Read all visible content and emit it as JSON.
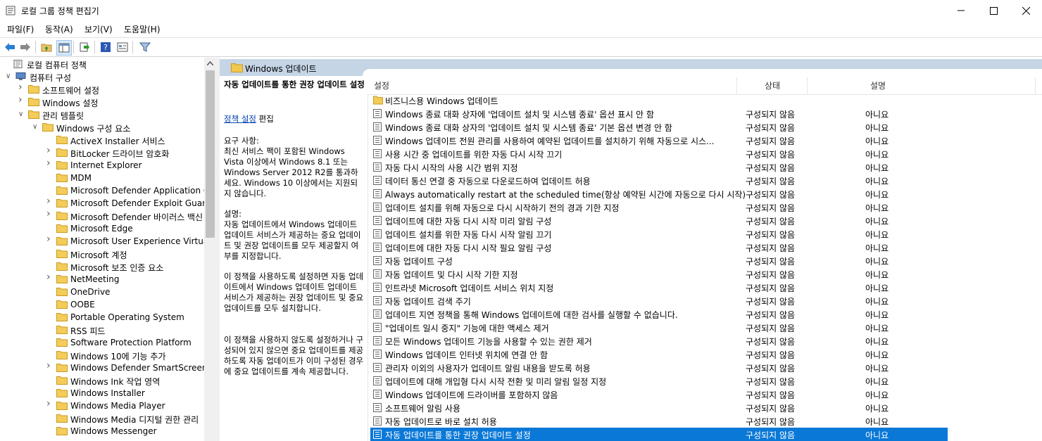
{
  "window": {
    "title": "로컬 그룹 정책 편집기"
  },
  "menu": [
    "파일(F)",
    "동작(A)",
    "보기(V)",
    "도움말(H)"
  ],
  "tree": [
    {
      "label": "로컬 컴퓨터 정책",
      "level": 0,
      "chev": "",
      "icon": "policy-icon"
    },
    {
      "label": "컴퓨터 구성",
      "level": 1,
      "chev": "open",
      "icon": "computer-icon"
    },
    {
      "label": "소프트웨어 설정",
      "level": 2,
      "chev": "closed",
      "icon": "folder-icon"
    },
    {
      "label": "Windows 설정",
      "level": 2,
      "chev": "closed",
      "icon": "folder-icon"
    },
    {
      "label": "관리 템플릿",
      "level": 2,
      "chev": "open",
      "icon": "folder-icon"
    },
    {
      "label": "Windows 구성 요소",
      "level": 3,
      "chev": "open",
      "icon": "folder-icon"
    },
    {
      "label": "ActiveX Installer 서비스",
      "level": 4,
      "chev": "",
      "icon": "folder-icon"
    },
    {
      "label": "BitLocker 드라이브 암호화",
      "level": 4,
      "chev": "closed",
      "icon": "folder-icon"
    },
    {
      "label": "Internet Explorer",
      "level": 4,
      "chev": "closed",
      "icon": "folder-icon"
    },
    {
      "label": "MDM",
      "level": 4,
      "chev": "",
      "icon": "folder-icon"
    },
    {
      "label": "Microsoft Defender Application Gu",
      "level": 4,
      "chev": "",
      "icon": "folder-icon"
    },
    {
      "label": "Microsoft Defender Exploit Guard",
      "level": 4,
      "chev": "closed",
      "icon": "folder-icon"
    },
    {
      "label": "Microsoft Defender 바이러스 백신",
      "level": 4,
      "chev": "closed",
      "icon": "folder-icon"
    },
    {
      "label": "Microsoft Edge",
      "level": 4,
      "chev": "",
      "icon": "folder-icon"
    },
    {
      "label": "Microsoft User Experience Virtualiz",
      "level": 4,
      "chev": "closed",
      "icon": "folder-icon"
    },
    {
      "label": "Microsoft 계정",
      "level": 4,
      "chev": "",
      "icon": "folder-icon"
    },
    {
      "label": "Microsoft 보조 인증 요소",
      "level": 4,
      "chev": "",
      "icon": "folder-icon"
    },
    {
      "label": "NetMeeting",
      "level": 4,
      "chev": "closed",
      "icon": "folder-icon"
    },
    {
      "label": "OneDrive",
      "level": 4,
      "chev": "",
      "icon": "folder-icon"
    },
    {
      "label": "OOBE",
      "level": 4,
      "chev": "",
      "icon": "folder-icon"
    },
    {
      "label": "Portable Operating System",
      "level": 4,
      "chev": "",
      "icon": "folder-icon"
    },
    {
      "label": "RSS 피드",
      "level": 4,
      "chev": "",
      "icon": "folder-icon"
    },
    {
      "label": "Software Protection Platform",
      "level": 4,
      "chev": "",
      "icon": "folder-icon"
    },
    {
      "label": "Windows 10에 기능 추가",
      "level": 4,
      "chev": "",
      "icon": "folder-icon"
    },
    {
      "label": "Windows Defender SmartScreen",
      "level": 4,
      "chev": "closed",
      "icon": "folder-icon"
    },
    {
      "label": "Windows Ink 작업 영역",
      "level": 4,
      "chev": "",
      "icon": "folder-icon"
    },
    {
      "label": "Windows Installer",
      "level": 4,
      "chev": "",
      "icon": "folder-icon"
    },
    {
      "label": "Windows Media Player",
      "level": 4,
      "chev": "closed",
      "icon": "folder-icon"
    },
    {
      "label": "Windows Media 디지털 권한 관리",
      "level": 4,
      "chev": "",
      "icon": "folder-icon"
    },
    {
      "label": "Windows Messenger",
      "level": 4,
      "chev": "",
      "icon": "folder-icon"
    }
  ],
  "panel": {
    "header": "Windows 업데이트",
    "desc_title": "자동 업데이트를 통한 권장 업데이트 설정",
    "edit_link": "정책 설정",
    "edit_suffix": "편집",
    "requirements": "요구 사항:\n최신 서비스 팩이 포함된 Windows Vista 이상에서 Windows 8.1 또는 Windows Server 2012 R2를 통과하세요. Windows 10 이상에서는 지원되지 않습니다.",
    "description": "설명:\n자동 업데이트에서 Windows 업데이트 업데이트 서비스가 제공하는 중요 업데이트 및 권장 업데이트를 모두 제공할지 여부를 지정합니다.",
    "para2": "이 정책을 사용하도록 설정하면 자동 업데이트에서 Windows 업데이트 업데이트 서비스가 제공하는 권장 업데이트 및 중요 업데이트를 모두 설치합니다.",
    "para3": "이 정책을 사용하지 않도록 설정하거나 구성되어 있지 않으면 중요 업데이트를 제공하도록 자동 업데이트가 이미 구성된 경우에 중요 업데이트를 계속 제공합니다."
  },
  "columns": {
    "setting": "설정",
    "state": "상태",
    "comment": "설명"
  },
  "rows": [
    {
      "name": "비즈니스용 Windows 업데이트",
      "state": "",
      "comment": "",
      "folder": true
    },
    {
      "name": "Windows 종료 대화 상자에 '업데이트 설치 및 시스템 종료' 옵션 표시 안 함",
      "state": "구성되지 않음",
      "comment": "아니요"
    },
    {
      "name": "Windows 종료 대화 상자의 '업데이트 설치 및 시스템 종료' 기본 옵션 변경 안 함",
      "state": "구성되지 않음",
      "comment": "아니요"
    },
    {
      "name": "Windows 업데이트 전원 관리를 사용하여 예약된 업데이트를 설치하기 위해 자동으로 시스...",
      "state": "구성되지 않음",
      "comment": "아니요"
    },
    {
      "name": "사용 시간 중 업데이트를 위한 자동 다시 시작 끄기",
      "state": "구성되지 않음",
      "comment": "아니요"
    },
    {
      "name": "자동 다시 시작의 사용 시간 범위 지정",
      "state": "구성되지 않음",
      "comment": "아니요"
    },
    {
      "name": "데이터 통신 연결 중 자동으로 다운로드하여 업데이트 허용",
      "state": "구성되지 않음",
      "comment": "아니요"
    },
    {
      "name": "Always automatically restart at the scheduled time(항상 예약된 시간에 자동으로 다시 시작)",
      "state": "구성되지 않음",
      "comment": "아니요"
    },
    {
      "name": "업데이트 설치를 위해 자동으로 다시 시작하기 전의 경과 기한 지정",
      "state": "구성되지 않음",
      "comment": "아니요"
    },
    {
      "name": "업데이트에 대한 자동 다시 시작 미리 알림 구성",
      "state": "구성되지 않음",
      "comment": "아니요"
    },
    {
      "name": "업데이트 설치를 위한 자동 다시 시작 알림 끄기",
      "state": "구성되지 않음",
      "comment": "아니요"
    },
    {
      "name": "업데이트에 대한 자동 다시 시작 필요 알림 구성",
      "state": "구성되지 않음",
      "comment": "아니요"
    },
    {
      "name": "자동 업데이트 구성",
      "state": "구성되지 않음",
      "comment": "아니요"
    },
    {
      "name": "자동 업데이트 및 다시 시작 기한 지정",
      "state": "구성되지 않음",
      "comment": "아니요"
    },
    {
      "name": "인트라넷 Microsoft 업데이트 서비스 위치 지정",
      "state": "구성되지 않음",
      "comment": "아니요"
    },
    {
      "name": "자동 업데이트 검색 주기",
      "state": "구성되지 않음",
      "comment": "아니요"
    },
    {
      "name": "업데이트 지연 정책을 통해 Windows 업데이트에 대한 검사를 실행할 수 없습니다.",
      "state": "구성되지 않음",
      "comment": "아니요"
    },
    {
      "name": "\"업데이트 일시 중지\" 기능에 대한 액세스 제거",
      "state": "구성되지 않음",
      "comment": "아니요"
    },
    {
      "name": "모든 Windows 업데이트 기능을 사용할 수 있는 권한 제거",
      "state": "구성되지 않음",
      "comment": "아니요"
    },
    {
      "name": "Windows 업데이트 인터넷 위치에 연결 안 함",
      "state": "구성되지 않음",
      "comment": "아니요"
    },
    {
      "name": "관리자 이외의 사용자가 업데이트 알림 내용을 받도록 허용",
      "state": "구성되지 않음",
      "comment": "아니요"
    },
    {
      "name": "업데이트에 대해 개입형 다시 시작 전환 및 미리 알림 일정 지정",
      "state": "구성되지 않음",
      "comment": "아니요"
    },
    {
      "name": "Windows 업데이트에 드라이버를 포함하지 않음",
      "state": "구성되지 않음",
      "comment": "아니요"
    },
    {
      "name": "소프트웨어 알림 사용",
      "state": "구성되지 않음",
      "comment": "아니요"
    },
    {
      "name": "자동 업데이트로 바로 설치 허용",
      "state": "구성되지 않음",
      "comment": "아니요"
    },
    {
      "name": "자동 업데이트를 통한 권장 업데이트 설정",
      "state": "구성되지 않음",
      "comment": "아니요",
      "selected": true
    }
  ]
}
